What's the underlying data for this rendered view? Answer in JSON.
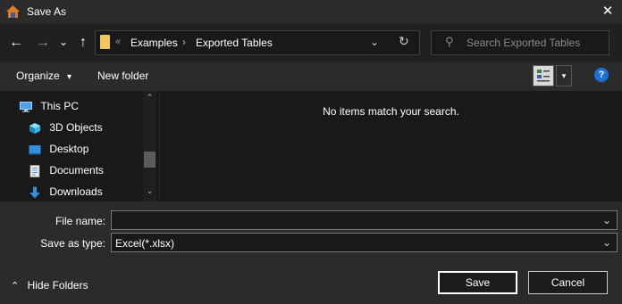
{
  "window": {
    "title": "Save As",
    "close_glyph": "✕"
  },
  "nav": {
    "back_glyph": "←",
    "forward_glyph": "→",
    "recent_glyph": "⌄",
    "up_glyph": "↑"
  },
  "address": {
    "overflow_glyph": "«",
    "breadcrumbs": [
      "Examples",
      "Exported Tables"
    ],
    "separator": "›",
    "dropdown_glyph": "⌄",
    "refresh_glyph": "↻"
  },
  "search": {
    "icon_glyph": "⚲",
    "placeholder": "Search Exported Tables"
  },
  "toolbar": {
    "organize_label": "Organize",
    "organize_arrow": "▾",
    "new_folder_label": "New folder",
    "view_dd_glyph": "▾",
    "help_glyph": "?"
  },
  "sidebar": {
    "scroll_up": "⌃",
    "scroll_down": "⌄",
    "items": [
      {
        "label": "This PC",
        "icon": "computer-icon"
      },
      {
        "label": "3D Objects",
        "icon": "cube-icon"
      },
      {
        "label": "Desktop",
        "icon": "desktop-icon"
      },
      {
        "label": "Documents",
        "icon": "documents-icon"
      },
      {
        "label": "Downloads",
        "icon": "download-arrow-icon"
      }
    ]
  },
  "content": {
    "empty_message": "No items match your search."
  },
  "form": {
    "filename_label": "File name:",
    "filename_value": "",
    "filetype_label": "Save as type:",
    "filetype_value": "Excel(*.xlsx)",
    "dropdown_glyph": "⌄"
  },
  "footer": {
    "hide_folders_glyph": "⌃",
    "hide_folders_label": "Hide Folders",
    "save_label": "Save",
    "cancel_label": "Cancel"
  },
  "colors": {
    "background": "#2b2b2b",
    "pane": "#191919",
    "accent": "#1e6fd9",
    "folder": "#f2c75c"
  }
}
